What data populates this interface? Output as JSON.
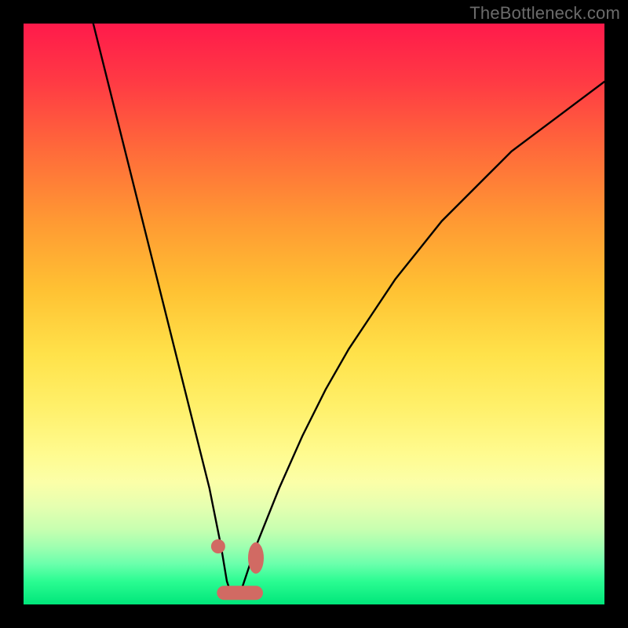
{
  "attribution": "TheBottleneck.com",
  "colors": {
    "frame": "#000000",
    "curve_stroke": "#000000",
    "marker_stroke": "#d16a63",
    "marker_fill": "#d16a63"
  },
  "chart_data": {
    "type": "line",
    "title": "",
    "xlabel": "",
    "ylabel": "",
    "xlim": [
      0,
      100
    ],
    "ylim": [
      0,
      100
    ],
    "series": [
      {
        "name": "bottleneck-curve",
        "x": [
          12,
          14,
          16,
          18,
          20,
          22,
          24,
          26,
          28,
          30,
          32,
          34,
          35,
          36,
          37,
          38,
          40,
          44,
          48,
          52,
          56,
          60,
          64,
          68,
          72,
          76,
          80,
          84,
          88,
          92,
          96,
          100
        ],
        "y": [
          100,
          92,
          84,
          76,
          68,
          60,
          52,
          44,
          36,
          28,
          20,
          10,
          4,
          1,
          1,
          4,
          10,
          20,
          29,
          37,
          44,
          50,
          56,
          61,
          66,
          70,
          74,
          78,
          81,
          84,
          87,
          90
        ]
      }
    ],
    "markers": [
      {
        "name": "left-dot",
        "x": 33.5,
        "y": 10
      },
      {
        "name": "right-blob",
        "x": 40.0,
        "y": 8
      }
    ],
    "flat_segment": {
      "x0": 34.5,
      "x1": 40.0,
      "y": 2
    }
  }
}
